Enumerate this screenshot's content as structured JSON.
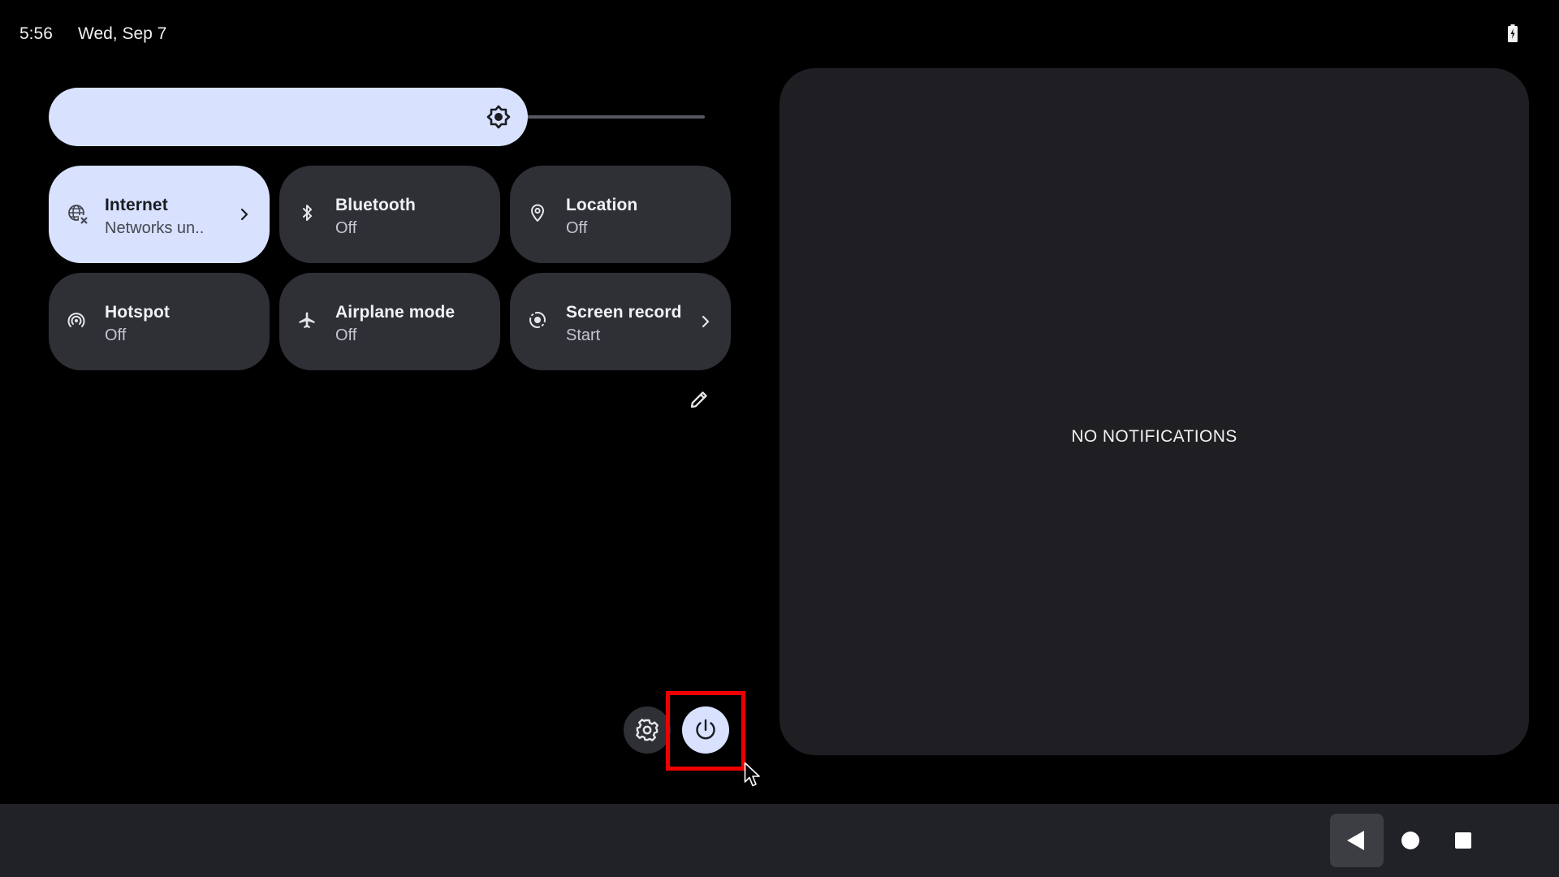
{
  "status_bar": {
    "time": "5:56",
    "date": "Wed, Sep 7",
    "battery_icon": "battery-charging-icon"
  },
  "brightness": {
    "level_fraction": 0.73,
    "icon": "brightness-icon"
  },
  "tiles": [
    {
      "title": "Internet",
      "subtitle": "Networks un..",
      "icon": "globe-x-icon",
      "active": true,
      "has_chevron": true
    },
    {
      "title": "Bluetooth",
      "subtitle": "Off",
      "icon": "bluetooth-icon",
      "active": false,
      "has_chevron": false
    },
    {
      "title": "Location",
      "subtitle": "Off",
      "icon": "location-pin-icon",
      "active": false,
      "has_chevron": false
    },
    {
      "title": "Hotspot",
      "subtitle": "Off",
      "icon": "hotspot-icon",
      "active": false,
      "has_chevron": false
    },
    {
      "title": "Airplane mode",
      "subtitle": "Off",
      "icon": "airplane-icon",
      "active": false,
      "has_chevron": false
    },
    {
      "title": "Screen record",
      "subtitle": "Start",
      "icon": "screen-record-icon",
      "active": false,
      "has_chevron": true
    }
  ],
  "notifications": {
    "empty_text": "NO NOTIFICATIONS"
  },
  "colors": {
    "accent": "#d8e2ff",
    "tile_inactive": "#2e3036",
    "panel": "#1f1f23",
    "highlight": "#ee0000"
  }
}
